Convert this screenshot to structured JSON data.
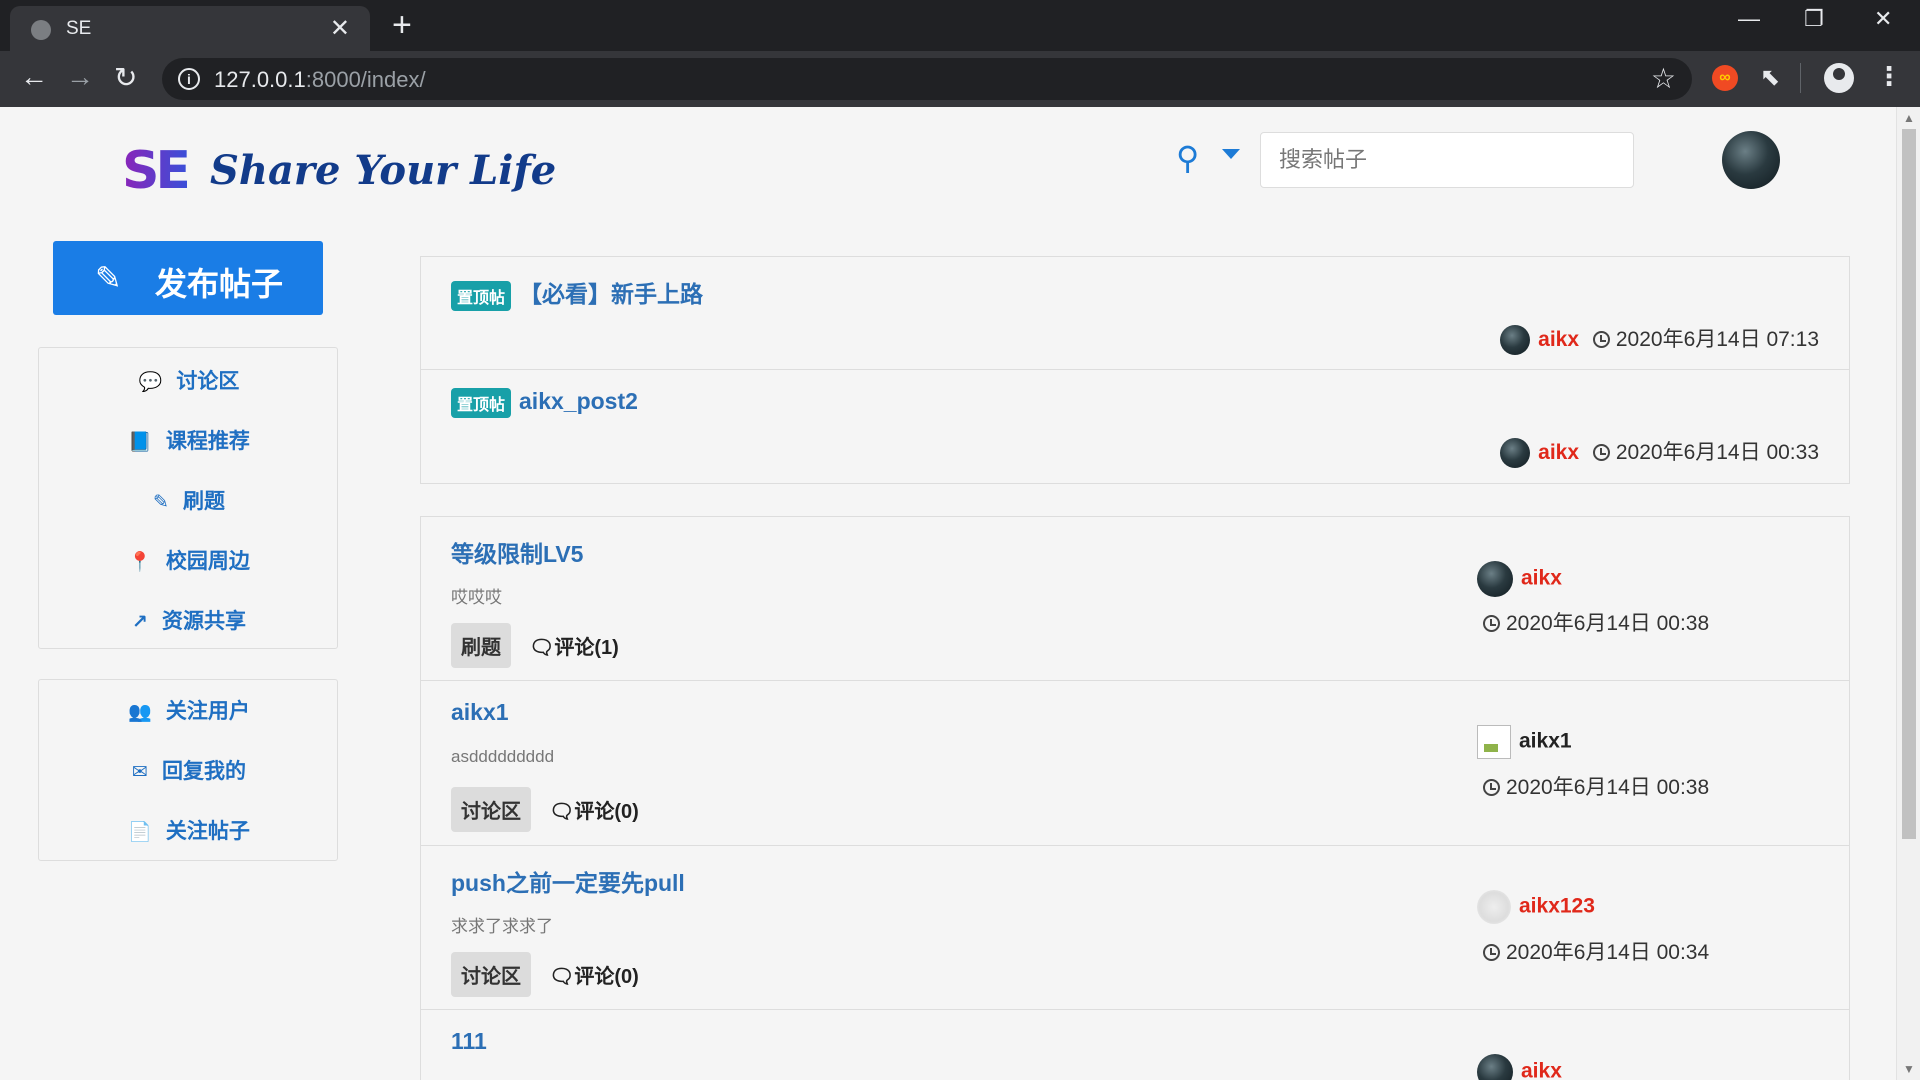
{
  "browser": {
    "tab_title": "SE",
    "tab_close": "✕",
    "new_tab": "+",
    "url_host": "127.0.0.1",
    "url_rest": ":8000/index/",
    "window_controls": [
      "—",
      "❐",
      "✕"
    ]
  },
  "header": {
    "logo_mark": "SE",
    "logo_tagline": "Share Your Life",
    "search_placeholder": "搜索帖子"
  },
  "sidebar": {
    "publish_label": "发布帖子",
    "menu1": [
      {
        "label": "讨论区",
        "icon": "comments-icon"
      },
      {
        "label": "课程推荐",
        "icon": "book-icon"
      },
      {
        "label": "刷题",
        "icon": "edit-icon"
      },
      {
        "label": "校园周边",
        "icon": "map-marker-icon"
      },
      {
        "label": "资源共享",
        "icon": "share-icon"
      }
    ],
    "menu2": [
      {
        "label": "关注用户",
        "icon": "users-icon"
      },
      {
        "label": "回复我的",
        "icon": "envelope-icon"
      },
      {
        "label": "关注帖子",
        "icon": "file-icon"
      }
    ]
  },
  "pinned": [
    {
      "badge": "置顶帖",
      "title": "【必看】新手上路",
      "author": "aikx",
      "time": "2020年6月14日 07:13"
    },
    {
      "badge": "置顶帖",
      "title": "aikx_post2",
      "author": "aikx",
      "time": "2020年6月14日 00:33"
    }
  ],
  "posts": [
    {
      "title": "等级限制LV5",
      "excerpt": "哎哎哎",
      "tag": "刷题",
      "comments": "评论(1)",
      "author": "aikx",
      "time": "2020年6月14日 00:38"
    },
    {
      "title": "aikx1",
      "excerpt": "asddddddddd",
      "tag": "讨论区",
      "comments": "评论(0)",
      "author": "aikx1",
      "time": "2020年6月14日 00:38"
    },
    {
      "title": "push之前一定要先pull",
      "excerpt": "求求了求求了",
      "tag": "讨论区",
      "comments": "评论(0)",
      "author": "aikx123",
      "time": "2020年6月14日 00:34"
    },
    {
      "title": "111",
      "author": "aikx"
    }
  ],
  "colors": {
    "accent": "#1a7de6",
    "author": "#e0281a",
    "link": "#2c6fb5",
    "pin_badge": "#18a0a8"
  }
}
